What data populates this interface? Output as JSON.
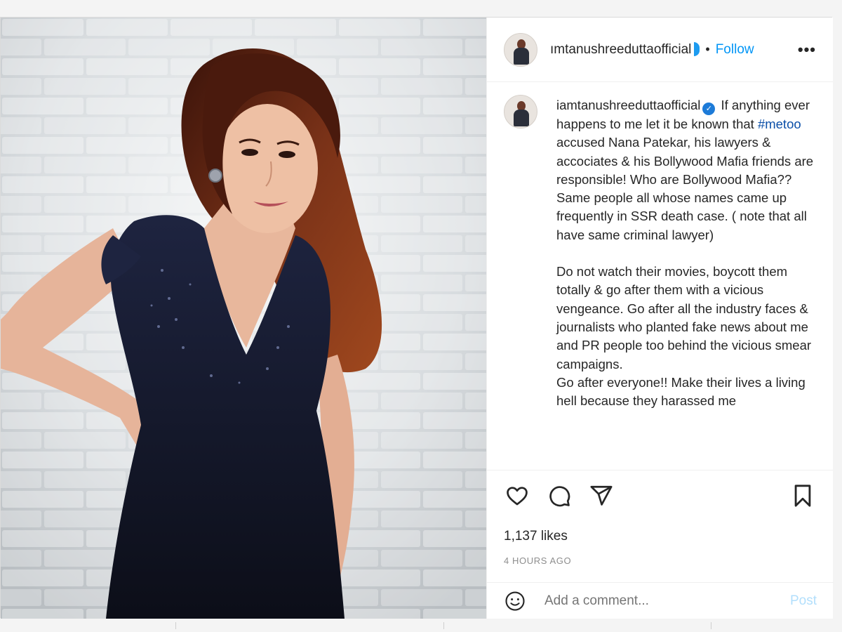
{
  "post": {
    "username": "ımtanushreeduttaofficial",
    "separator": "•",
    "follow_label": "Follow",
    "more_label": "•••"
  },
  "caption": {
    "username": "iamtanushreeduttaofficial",
    "verified_glyph": "✓",
    "line_intro": "If anything ever happens to me let it be known that ",
    "hashtag": "#metoo",
    "paragraph1_rest": " accused Nana Patekar, his lawyers & accociates & his Bollywood Mafia friends are responsible! Who are Bollywood Mafia?? Same people all whose names came up frequently in SSR death case. ( note that all have same criminal lawyer)",
    "paragraph2": "Do not watch their movies, boycott them totally & go after them with a vicious vengeance. Go after all the industry faces & journalists who planted fake news about me and PR people too behind the vicious smear campaigns.",
    "paragraph3": "Go after everyone!! Make their lives a living hell because they harassed me"
  },
  "actions": {
    "like_icon": "heart-icon",
    "comment_icon": "comment-bubble-icon",
    "share_icon": "paper-plane-icon",
    "save_icon": "bookmark-icon"
  },
  "stats": {
    "likes": "1,137 likes",
    "timestamp": "4 HOURS AGO"
  },
  "comment_box": {
    "placeholder": "Add a comment...",
    "post_label": "Post",
    "emoji_icon": "smiley-icon"
  },
  "colors": {
    "accent": "#0095f6",
    "post_disabled": "#b2dffc",
    "hashtag": "#0b4fa8",
    "dress": "#14182a",
    "hair": "#5a2414"
  }
}
